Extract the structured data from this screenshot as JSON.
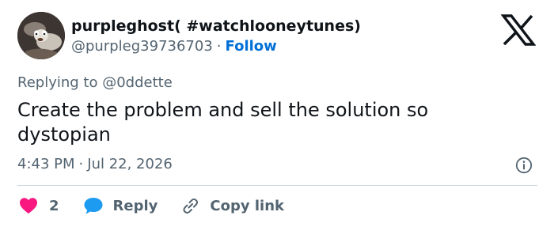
{
  "author": {
    "display_name": "purpleghost( #watchlooneytunes)",
    "handle": "@purpleg39736703",
    "separator": "·",
    "follow_label": "Follow"
  },
  "replying_to": "Replying to @0ddette",
  "tweet": {
    "text": "Create the problem and sell the solution so dystopian"
  },
  "meta": {
    "time": "4:43 PM",
    "separator": "·",
    "date": "Jul 22, 2026"
  },
  "actions": {
    "like_count": "2",
    "reply_label": "Reply",
    "copy_label": "Copy link"
  },
  "icons": {
    "brand": "x-logo-icon",
    "info": "info-icon",
    "like": "heart-icon",
    "reply": "speech-bubble-icon",
    "copy": "link-icon"
  },
  "colors": {
    "like": "#f91880",
    "reply": "#1d9bf0",
    "follow": "#006fd6",
    "secondary_text": "#536471",
    "primary_text": "#0f1419"
  }
}
